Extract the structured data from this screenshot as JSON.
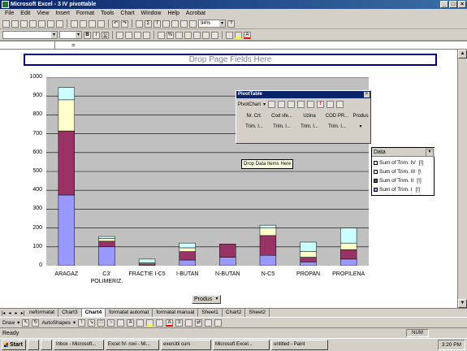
{
  "window": {
    "title": "Microsoft Excel - 3 IV pivottable"
  },
  "menu": [
    "File",
    "Edit",
    "View",
    "Insert",
    "Format",
    "Tools",
    "Chart",
    "Window",
    "Help",
    "Acrobat"
  ],
  "toolbar": {
    "zoom": "94%",
    "help": "?"
  },
  "formula_bar": {
    "equals": "="
  },
  "chart": {
    "drop_page_fields": "Drop Page Fields Here",
    "drop_data_items": "Drop Data Items Here",
    "field_button": "Produs"
  },
  "chart_data": {
    "type": "bar",
    "stacked": true,
    "categories": [
      "ARAGAZ",
      "C3' POLIMERIZ.",
      "FRACTIE I-C5",
      "I-BUTAN",
      "N-BUTAN",
      "N-C5",
      "PROPAN",
      "PROPILENA"
    ],
    "series": [
      {
        "name": "Sum of Trim. I",
        "color": "#9999ff",
        "values": [
          375,
          100,
          0,
          30,
          45,
          55,
          20,
          35
        ]
      },
      {
        "name": "Sum of Trim. II",
        "color": "#993366",
        "values": [
          340,
          30,
          10,
          45,
          70,
          105,
          25,
          50
        ]
      },
      {
        "name": "Sum of Trim. III",
        "color": "#ffffcc",
        "values": [
          165,
          15,
          5,
          20,
          0,
          40,
          30,
          35
        ]
      },
      {
        "name": "Sum of Trim. IV",
        "color": "#ccffff",
        "values": [
          65,
          10,
          20,
          25,
          0,
          15,
          50,
          80
        ]
      }
    ],
    "ylim": [
      0,
      1000
    ],
    "yticks": [
      0,
      100,
      200,
      300,
      400,
      500,
      600,
      700,
      800,
      900,
      1000
    ],
    "grid": true,
    "legend_title": "Data",
    "legend_placement": "right"
  },
  "pivot_toolbar": {
    "title": "PivotTable",
    "menu": "PivotChart",
    "fields": [
      "Nr. Crt.",
      "Cod sfe...",
      "Uzina",
      "COD PR...",
      "Produs",
      "Trim. I...",
      "Trim. I...",
      "Trim. I...",
      "Trim. I..."
    ]
  },
  "legend_items": [
    {
      "label": "Sum of Trim. IV",
      "suffix": "[!]"
    },
    {
      "label": "Sum of Trim. III",
      "suffix": "[!"
    },
    {
      "label": "Sum of Trim. II",
      "suffix": "[!]"
    },
    {
      "label": "Sum of Trim. I",
      "suffix": "[!]"
    }
  ],
  "sheet_tabs": [
    {
      "label": "neformatat",
      "active": false
    },
    {
      "label": "Chart3",
      "active": false
    },
    {
      "label": "Chart4",
      "active": true
    },
    {
      "label": "formatat automat",
      "active": false
    },
    {
      "label": "formatat manual",
      "active": false
    },
    {
      "label": "Sheet1",
      "active": false
    },
    {
      "label": "Chart2",
      "active": false
    },
    {
      "label": "Sheet2",
      "active": false
    }
  ],
  "draw_toolbar": {
    "draw": "Draw",
    "autoshapes": "AutoShapes"
  },
  "status": {
    "text": "Ready",
    "num": "NUM"
  },
  "taskbar": {
    "start": "Start",
    "tasks": [
      {
        "label": "Inbox - Microsoft...",
        "active": false
      },
      {
        "label": "Excel IV- roxi - Mi...",
        "active": false
      },
      {
        "label": "exercitii curs",
        "active": false
      },
      {
        "label": "Microsoft Excel...",
        "active": true
      },
      {
        "label": "untitled - Paint",
        "active": false
      }
    ],
    "clock": "3:20 PM"
  }
}
